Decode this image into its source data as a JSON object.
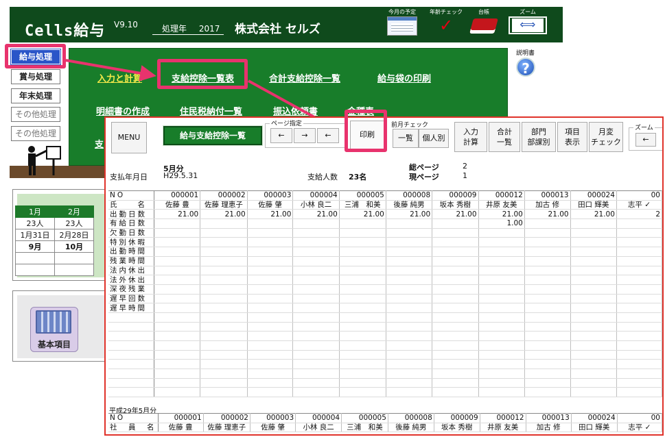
{
  "app": {
    "title": "Cells給与",
    "version": "V9.10",
    "year_label": "処理年",
    "year": "2017",
    "company": "株式会社 セルズ"
  },
  "toolbar": {
    "schedule": "今月の予定",
    "annual_check": "年齢チェック",
    "ledger": "台帳",
    "zoom": "ズーム",
    "help": "説明書"
  },
  "sidebar": [
    {
      "label": "給与処理",
      "state": "active"
    },
    {
      "label": "賞与処理",
      "state": "normal"
    },
    {
      "label": "年末処理",
      "state": "normal"
    },
    {
      "label": "その他処理",
      "state": "dim"
    },
    {
      "label": "その他処理",
      "state": "dim"
    }
  ],
  "menu": {
    "input": "入力と計算",
    "payroll_list": "支給控除一覧表",
    "total_list": "合計支給控除一覧",
    "envelope": "給与袋の印刷",
    "statement": "明細書の作成",
    "resident_tax": "住民税納付一覧",
    "transfer": "振込依頼書",
    "kinds": "金種表",
    "cut": "支"
  },
  "calendar": {
    "months": [
      "1月",
      "2月"
    ],
    "people": [
      "23人",
      "23人"
    ],
    "dates": [
      "1月31日",
      "2月28日"
    ],
    "next": [
      "9月",
      "10月"
    ]
  },
  "basic": {
    "label": "基本項目"
  },
  "report": {
    "menu": "MENU",
    "title": "給与支給控除一覧",
    "page_group": "ページ指定",
    "prev": "←",
    "next": "→",
    "first": "←",
    "print": "印刷",
    "prev_month_group": "前月チェック",
    "list": "一覧",
    "individual": "個人別",
    "input_calc": "入力\n計算",
    "total_list": "合計\n一覧",
    "dept": "部門\n部課別",
    "item_display": "項目\n表示",
    "monthly_check": "月変\nチェック",
    "zoom_group": "ズーム",
    "pay_date_label": "支払年月日",
    "month": "5月分",
    "pay_date": "H29.5.31",
    "count_label": "支給人数",
    "count": "23名",
    "total_pages_label": "総ページ",
    "total_pages": "2",
    "current_page_label": "現ページ",
    "current_page": "1",
    "footer_label": "平成29年5月分"
  },
  "table": {
    "row_labels": [
      "NO",
      "氏　　名",
      "出勤日数",
      "有給日数",
      "欠勤日数",
      "特別休暇",
      "出勤時間",
      "残業時間",
      "法内休出",
      "法外休出",
      "深夜残業",
      "遅早回数",
      "遅早時間"
    ],
    "employees": [
      {
        "no": "000001",
        "name": "佐藤 豊",
        "work_days": "21.00",
        "paid_days": ""
      },
      {
        "no": "000002",
        "name": "佐藤 理恵子",
        "work_days": "21.00",
        "paid_days": ""
      },
      {
        "no": "000003",
        "name": "佐藤 肇",
        "work_days": "21.00",
        "paid_days": ""
      },
      {
        "no": "000004",
        "name": "小林 良二",
        "work_days": "21.00",
        "paid_days": ""
      },
      {
        "no": "000005",
        "name": "三浦　和美",
        "work_days": "21.00",
        "paid_days": ""
      },
      {
        "no": "000008",
        "name": "後藤 純男",
        "work_days": "21.00",
        "paid_days": ""
      },
      {
        "no": "000009",
        "name": "坂本 秀樹",
        "work_days": "21.00",
        "paid_days": ""
      },
      {
        "no": "000012",
        "name": "井原 友美",
        "work_days": "21.00",
        "paid_days": "1.00"
      },
      {
        "no": "000013",
        "name": "加古 修",
        "work_days": "21.00",
        "paid_days": ""
      },
      {
        "no": "000024",
        "name": "田口 輝美",
        "work_days": "21.00",
        "paid_days": ""
      },
      {
        "no": "00",
        "name": "志平 ✓",
        "work_days": "2",
        "paid_days": ""
      }
    ],
    "footer_labels": [
      "NO",
      "社　員　名"
    ]
  }
}
